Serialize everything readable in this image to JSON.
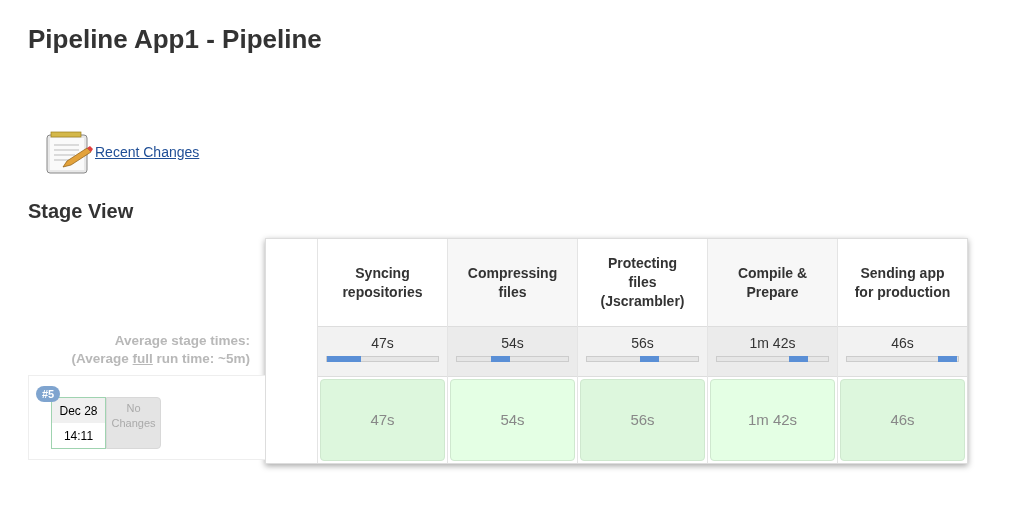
{
  "title": "Pipeline App1 - Pipeline",
  "recent_changes": {
    "label": "Recent Changes"
  },
  "stage_view": {
    "heading": "Stage View",
    "average_label": "Average stage times:",
    "average_full": {
      "prefix": "(Average ",
      "link": "full",
      "suffix": " run time: ~5m)"
    },
    "stages": [
      {
        "name": "Syncing repositories",
        "average": "47s"
      },
      {
        "name": "Compressing files",
        "average": "54s"
      },
      {
        "name": "Protecting files (Jscrambler)",
        "average": "56s"
      },
      {
        "name": "Compile & Prepare",
        "average": "1m 42s"
      },
      {
        "name": "Sending app for production",
        "average": "46s"
      }
    ],
    "builds": [
      {
        "number": "#5",
        "date": "Dec 28",
        "time": "14:11",
        "changes": "No Changes",
        "stage_times": [
          "47s",
          "54s",
          "56s",
          "1m 42s",
          "46s"
        ]
      }
    ]
  }
}
